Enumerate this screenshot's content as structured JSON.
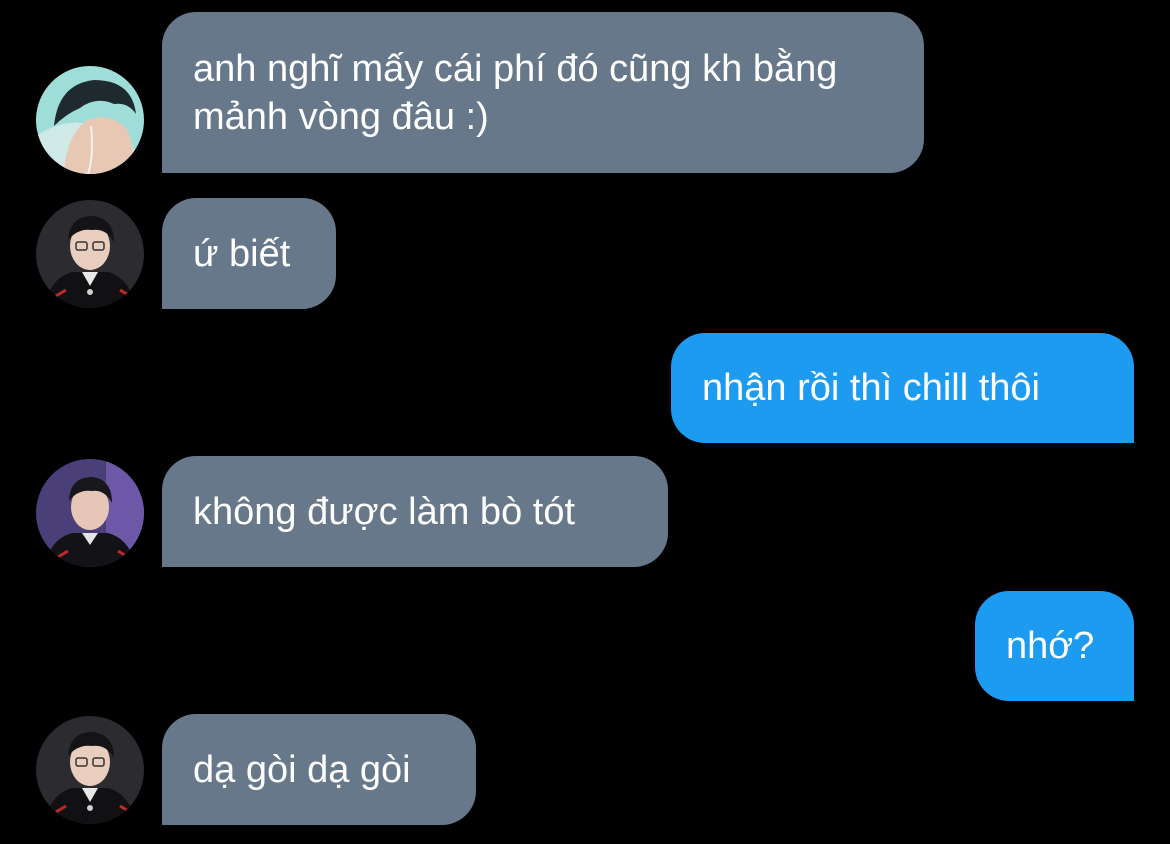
{
  "colors": {
    "background": "#000000",
    "incoming_bubble": "#66788a",
    "outgoing_bubble": "#1d9bf0",
    "text": "#ffffff"
  },
  "messages": [
    {
      "direction": "incoming",
      "avatar": "avatar-teal-profile",
      "text": "anh nghĩ mấy cái phí đó cũng kh bằng mảnh vòng đâu :)"
    },
    {
      "direction": "incoming",
      "avatar": "avatar-glasses-player",
      "text": "ứ biết"
    },
    {
      "direction": "outgoing",
      "text": "nhận rồi thì chill thôi"
    },
    {
      "direction": "incoming",
      "avatar": "avatar-purple-player",
      "text": "không được làm bò tót"
    },
    {
      "direction": "outgoing",
      "text": "nhớ?"
    },
    {
      "direction": "incoming",
      "avatar": "avatar-glasses-player",
      "text": "dạ gòi dạ gòi"
    }
  ]
}
